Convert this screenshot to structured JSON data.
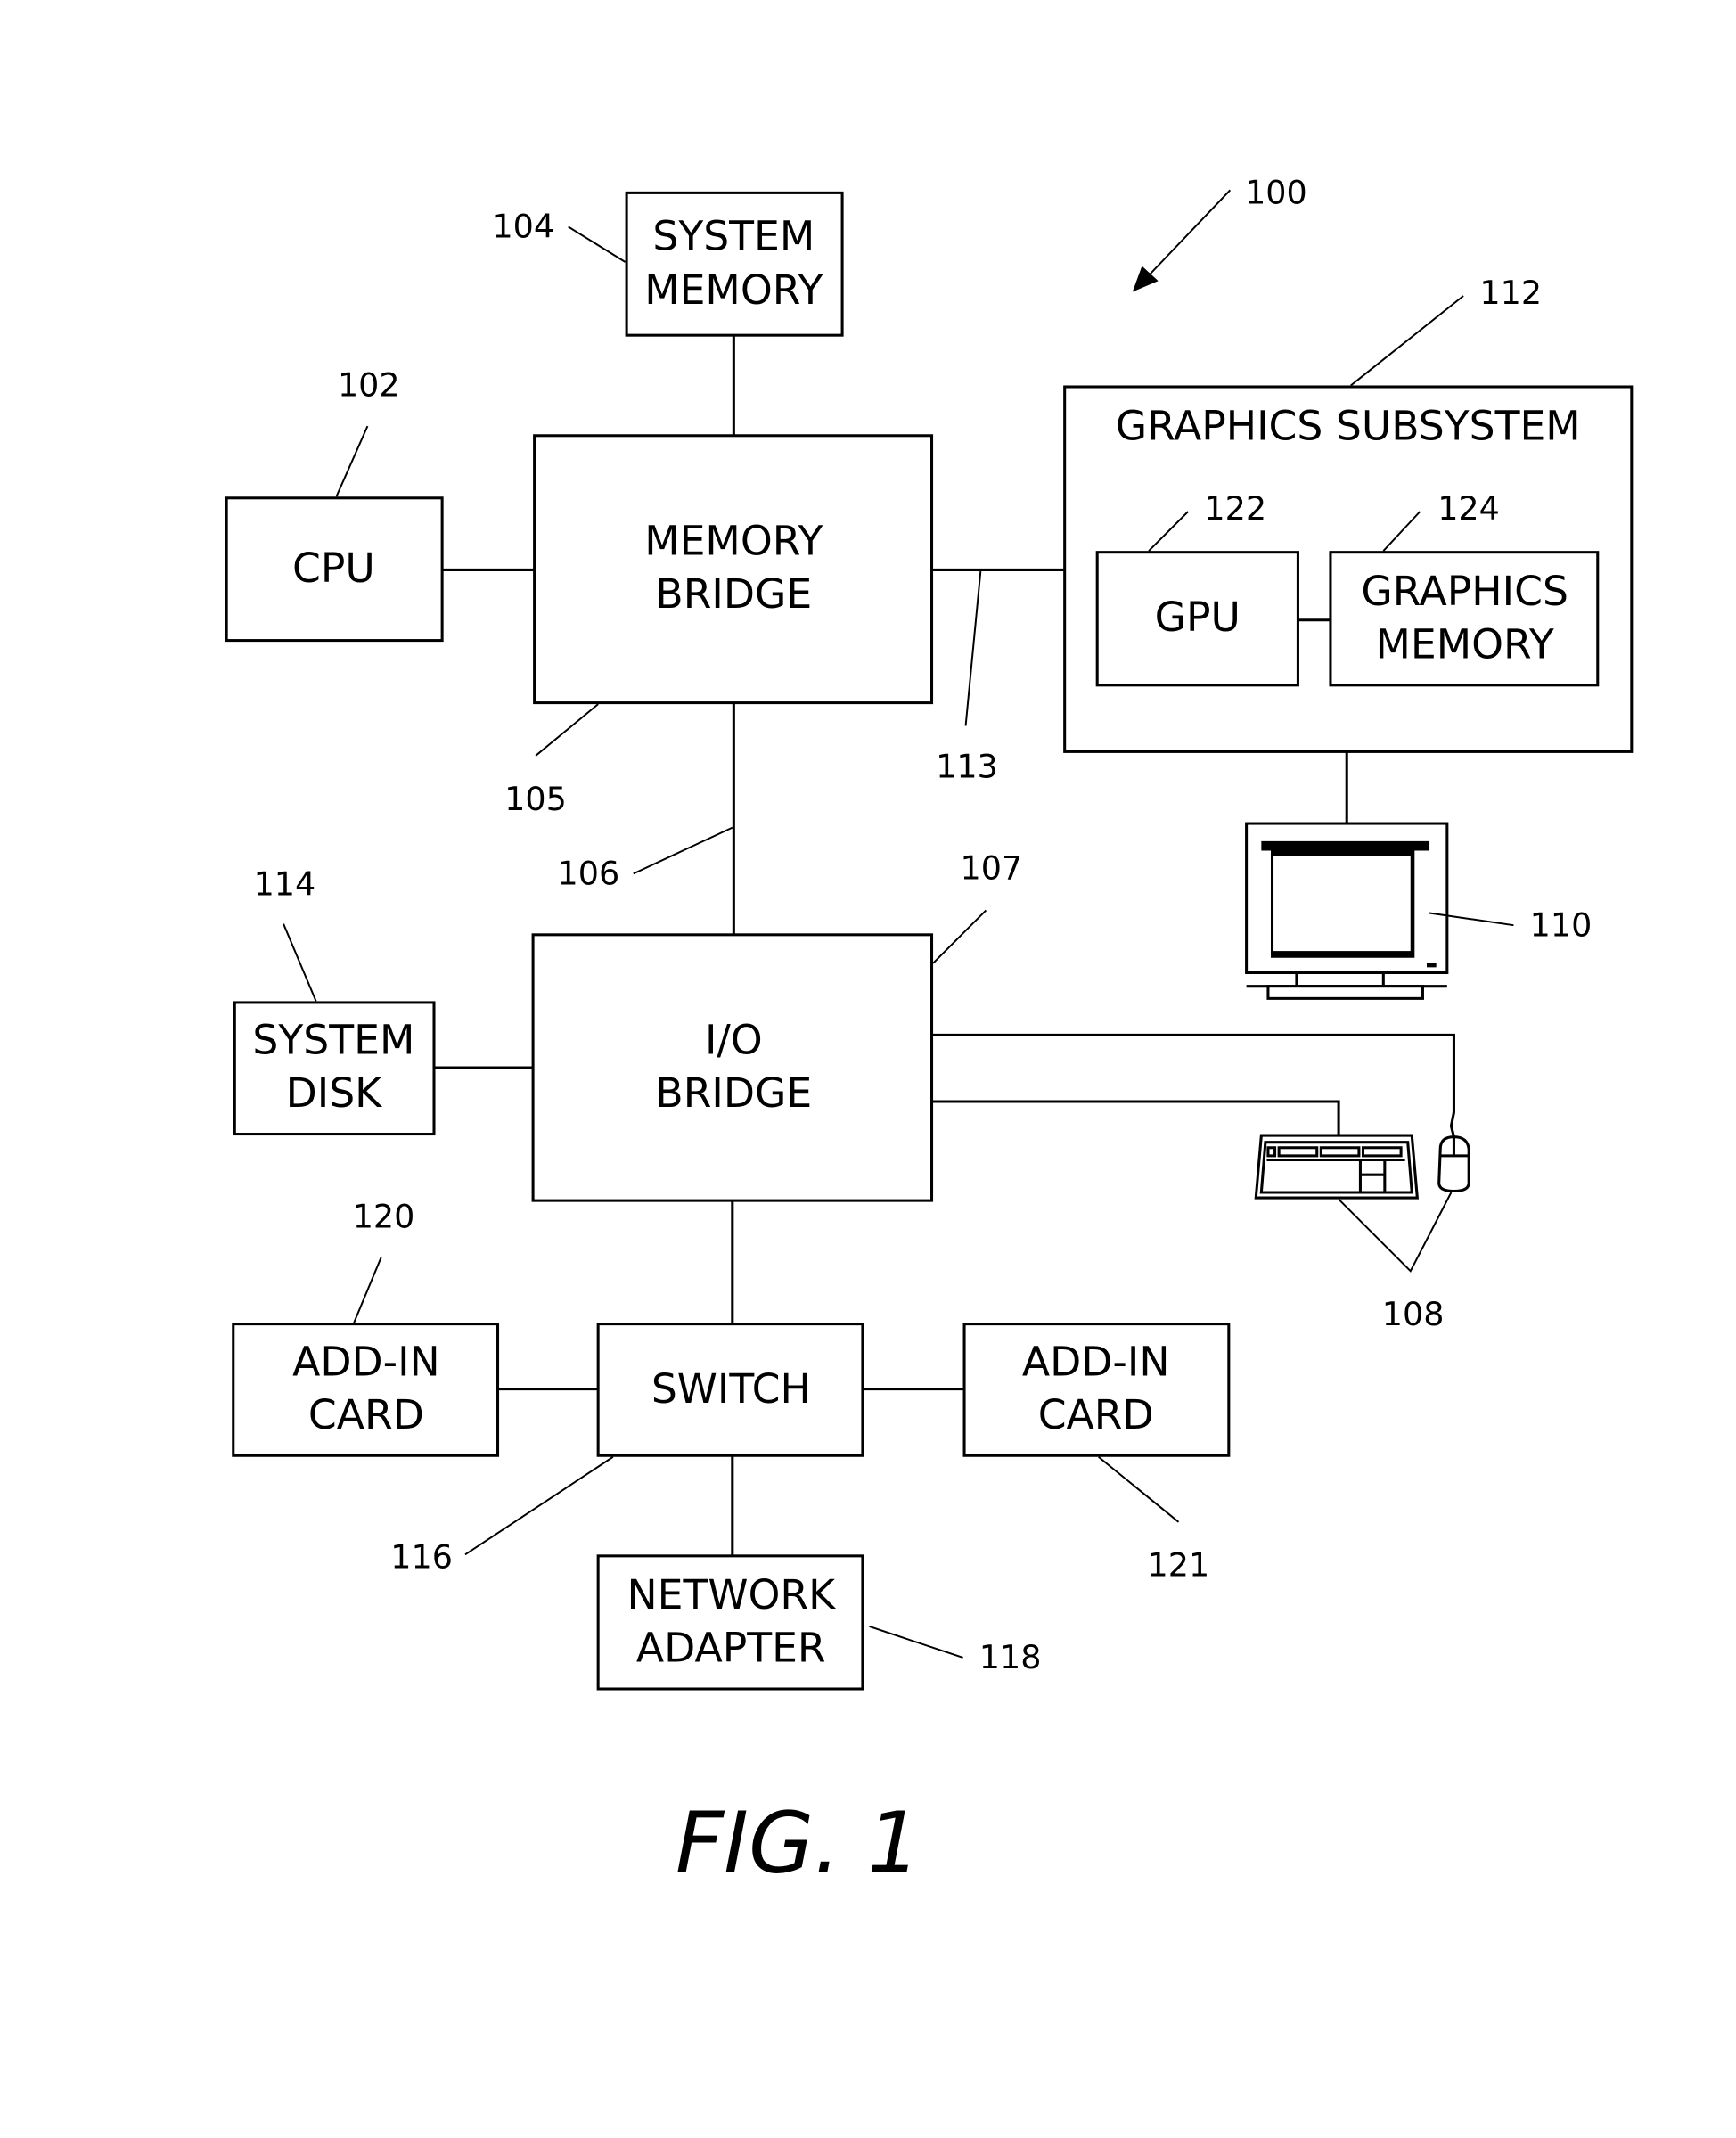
{
  "figure": {
    "caption": "FIG. 1",
    "system_ref": "100"
  },
  "blocks": {
    "system_memory": {
      "ref": "104",
      "lines": [
        "SYSTEM",
        "MEMORY"
      ]
    },
    "cpu": {
      "ref": "102",
      "lines": [
        "CPU"
      ]
    },
    "memory_bridge": {
      "ref": "105",
      "lines": [
        "MEMORY",
        "BRIDGE"
      ]
    },
    "graphics_subsystem": {
      "ref": "112",
      "lines": [
        "GRAPHICS SUBSYSTEM"
      ]
    },
    "gpu": {
      "ref": "122",
      "lines": [
        "GPU"
      ]
    },
    "graphics_memory": {
      "ref": "124",
      "lines": [
        "GRAPHICS",
        "MEMORY"
      ]
    },
    "display": {
      "ref": "110"
    },
    "io_bridge": {
      "ref": "107",
      "lines": [
        "I/O",
        "BRIDGE"
      ]
    },
    "system_disk": {
      "ref": "114",
      "lines": [
        "SYSTEM",
        "DISK"
      ]
    },
    "input_devices": {
      "ref": "108"
    },
    "switch": {
      "ref": "116",
      "lines": [
        "SWITCH"
      ]
    },
    "add_in_card_left": {
      "ref": "120",
      "lines": [
        "ADD-IN",
        "CARD"
      ]
    },
    "add_in_card_right": {
      "ref": "121",
      "lines": [
        "ADD-IN",
        "CARD"
      ]
    },
    "network_adapter": {
      "ref": "118",
      "lines": [
        "NETWORK",
        "ADAPTER"
      ]
    }
  },
  "links": {
    "communication_path_113": "113",
    "communication_path_106": "106"
  }
}
